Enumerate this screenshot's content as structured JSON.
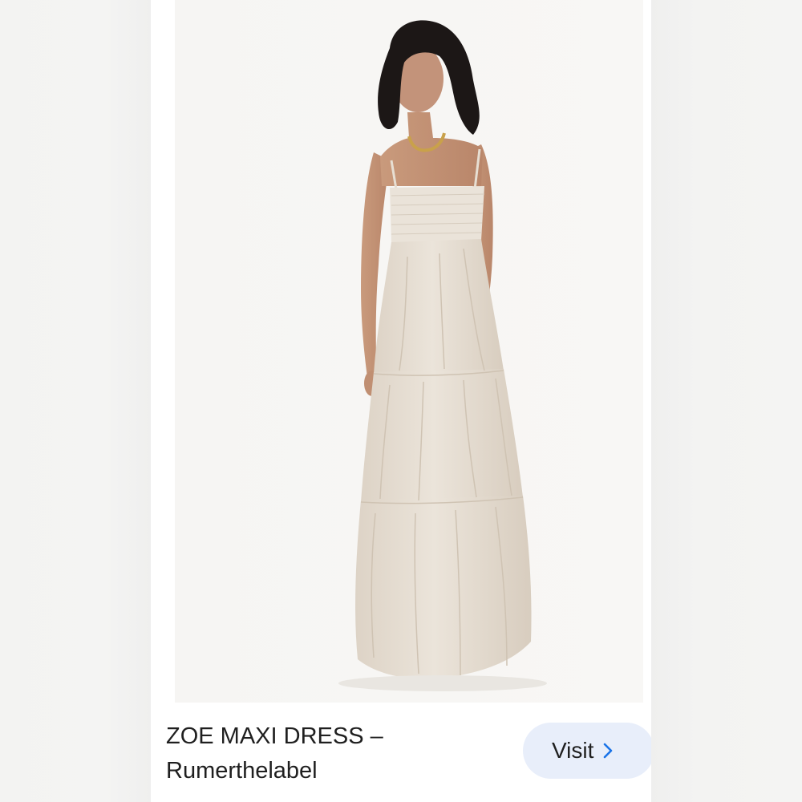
{
  "result": {
    "image_alt": "Woman wearing a beige tiered maxi dress with thin straps",
    "title_line1": "ZOE MAXI DRESS –",
    "title_line2": "Rumerthelabel",
    "visit_label": "Visit",
    "visit_icon": "chevron-right-icon"
  },
  "colors": {
    "page_bg": "#f5f5f4",
    "card_bg": "#ffffff",
    "photo_bg": "#f7f6f4",
    "dress": "#e8e0d5",
    "button_bg": "#e8eefa",
    "chevron": "#1a73e8",
    "text": "#1f1f1f"
  }
}
